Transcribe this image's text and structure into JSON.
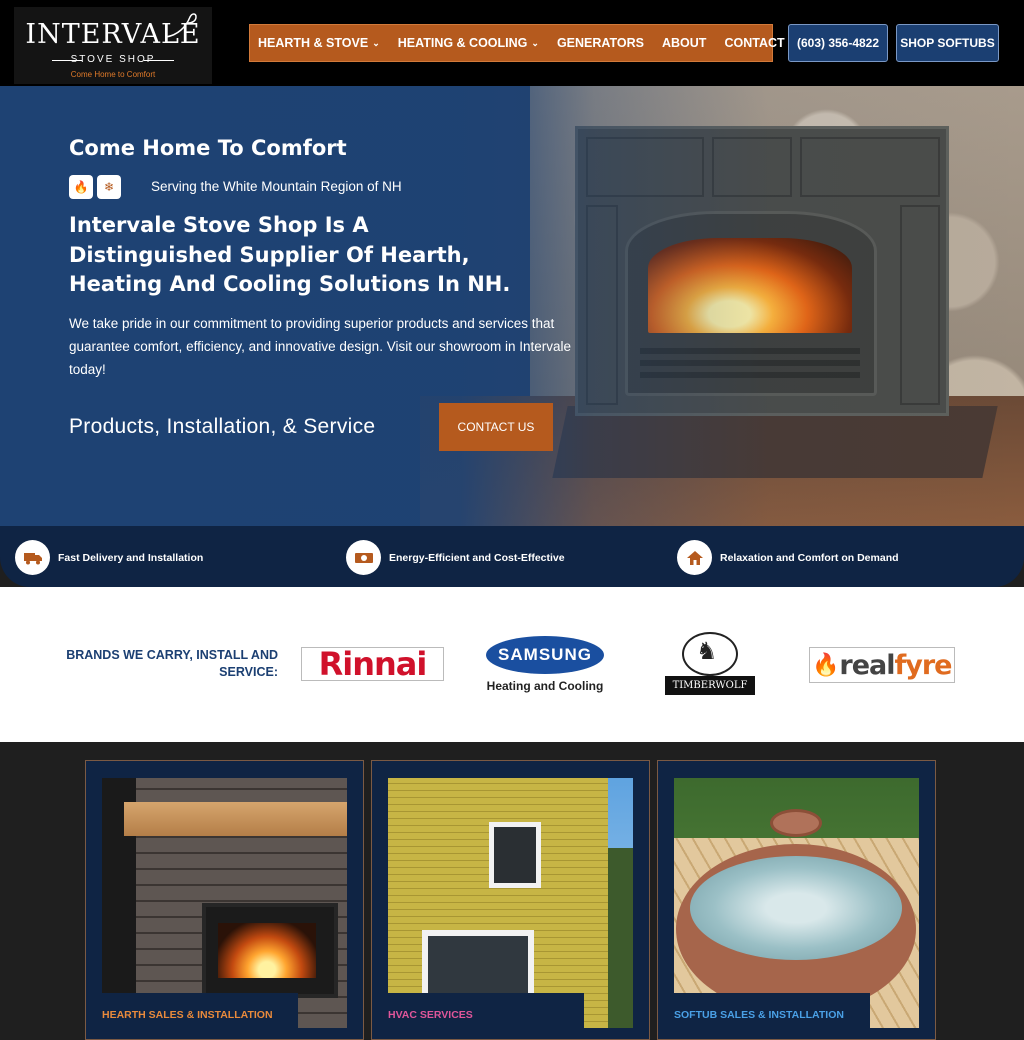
{
  "header": {
    "logo": {
      "name": "INTERVALE",
      "sub": "STOVE SHOP",
      "tagline": "Come Home to Comfort"
    },
    "nav": [
      {
        "label": "HEARTH & STOVE",
        "dropdown": true
      },
      {
        "label": "HEATING & COOLING",
        "dropdown": true
      },
      {
        "label": "GENERATORS",
        "dropdown": false
      },
      {
        "label": "ABOUT",
        "dropdown": false
      },
      {
        "label": "CONTACT",
        "dropdown": false
      }
    ],
    "phone": "(603) 356-4822",
    "shop_button": "SHOP SOFTUBS"
  },
  "hero": {
    "kicker": "Come Home To Comfort",
    "region": "Serving the White Mountain Region of NH",
    "headline": "Intervale Stove Shop Is A Distinguished Supplier Of Hearth, Heating And Cooling Solutions In NH.",
    "paragraph": "We take pride in our commitment to providing superior products and services that guarantee comfort, efficiency, and innovative design. Visit our showroom in Intervale today!",
    "services_line": "Products, Installation, & Service",
    "cta": "CONTACT US"
  },
  "features": [
    {
      "icon": "truck-icon",
      "label": "Fast Delivery and Installation"
    },
    {
      "icon": "money-icon",
      "label": "Energy-Efficient and Cost-Effective"
    },
    {
      "icon": "home-icon",
      "label": "Relaxation and Comfort on Demand"
    }
  ],
  "brands": {
    "label": "BRANDS WE CARRY, INSTALL AND SERVICE:",
    "rinnai": "Rinnai",
    "samsung": "SAMSUNG",
    "samsung_sub": "Heating and Cooling",
    "timberwolf": "TIMBERWOLF",
    "realfyre_a": "real",
    "realfyre_b": "fyre"
  },
  "cards": [
    {
      "label": "HEARTH SALES & INSTALLATION",
      "color": "#e98a3c"
    },
    {
      "label": "HVAC SERVICES",
      "color": "#e0569a"
    },
    {
      "label": "SOFTUB SALES & INSTALLATION",
      "color": "#4aa0e6"
    }
  ],
  "colors": {
    "accent": "#b55a1e",
    "navy": "#1b3f72",
    "dark_navy": "#0f2444"
  }
}
